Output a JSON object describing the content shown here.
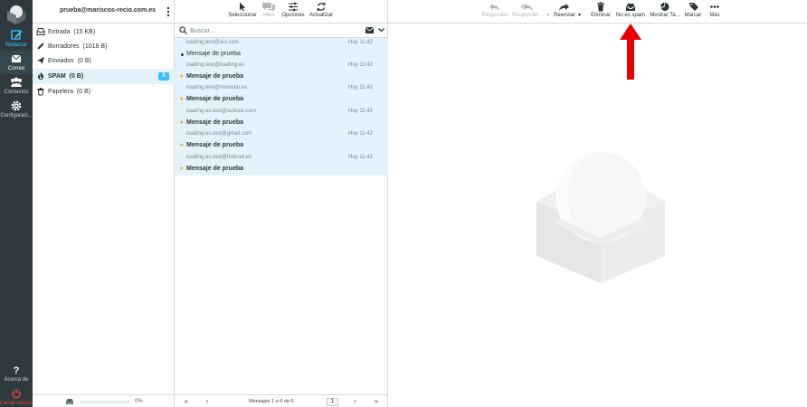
{
  "nav": {
    "compose": "Redactar",
    "mail": "Correo",
    "contacts": "Contactos",
    "settings": "Configuraci...",
    "about": "Acerca de",
    "logout": "Cerrar sesión"
  },
  "account": {
    "email": "prueba@mariscos-recio.com.es"
  },
  "folders": [
    {
      "name": "Entrada",
      "size": "(15 KB)",
      "icon": "inbox-icon"
    },
    {
      "name": "Borradores",
      "size": "(1018 B)",
      "icon": "pencil-icon"
    },
    {
      "name": "Enviados",
      "size": "(0 B)",
      "icon": "paper-plane-icon"
    },
    {
      "name": "SPAM",
      "size": "(0 B)",
      "icon": "fire-icon",
      "badge": "5",
      "selected": true
    },
    {
      "name": "Papelera",
      "size": "(0 B)",
      "icon": "trash-icon"
    }
  ],
  "quota": {
    "percent_text": "0%",
    "fill_fraction": 0.0
  },
  "list_toolbar": {
    "select": "Seleccionar",
    "threads": "Hilos",
    "options": "Opciones",
    "refresh": "Actualizar"
  },
  "search": {
    "placeholder": "Buscar..."
  },
  "messages": [
    {
      "from": "loading.test@aol.com",
      "date": "Hoy 11:42",
      "subject": "Mensaje de prueba",
      "read": true
    },
    {
      "from": "loading.test@loading.es",
      "date": "Hoy 11:42",
      "subject": "Mensaje de prueba",
      "read": false
    },
    {
      "from": "loading.test@movistar.es",
      "date": "Hoy 11:42",
      "subject": "Mensaje de prueba",
      "read": false
    },
    {
      "from": "loading.es.test@outlook.com",
      "date": "Hoy 11:42",
      "subject": "Mensaje de prueba",
      "read": false
    },
    {
      "from": "loading.es.test@gmail.com",
      "date": "Hoy 11:42",
      "subject": "Mensaje de prueba",
      "read": false
    },
    {
      "from": "loading.es.test@hotmail.es",
      "date": "Hoy 11:42",
      "subject": "Mensaje de prueba",
      "read": false
    }
  ],
  "pager": {
    "text": "Mensajes 1 a 6 de 6",
    "page": "1"
  },
  "preview_toolbar": {
    "reply": "Responder",
    "reply_all": "Responder ...",
    "forward": "Reenviar",
    "delete": "Eliminar",
    "not_spam": "No es spam",
    "show_as": "Mostrar Ta...",
    "mark": "Marcar",
    "more": "Más"
  },
  "colors": {
    "accent": "#37beff",
    "nav_bg": "#2f3a3f",
    "selected_bg": "#e4f3fb",
    "arrow": "#e60000",
    "logout": "#e64444"
  }
}
